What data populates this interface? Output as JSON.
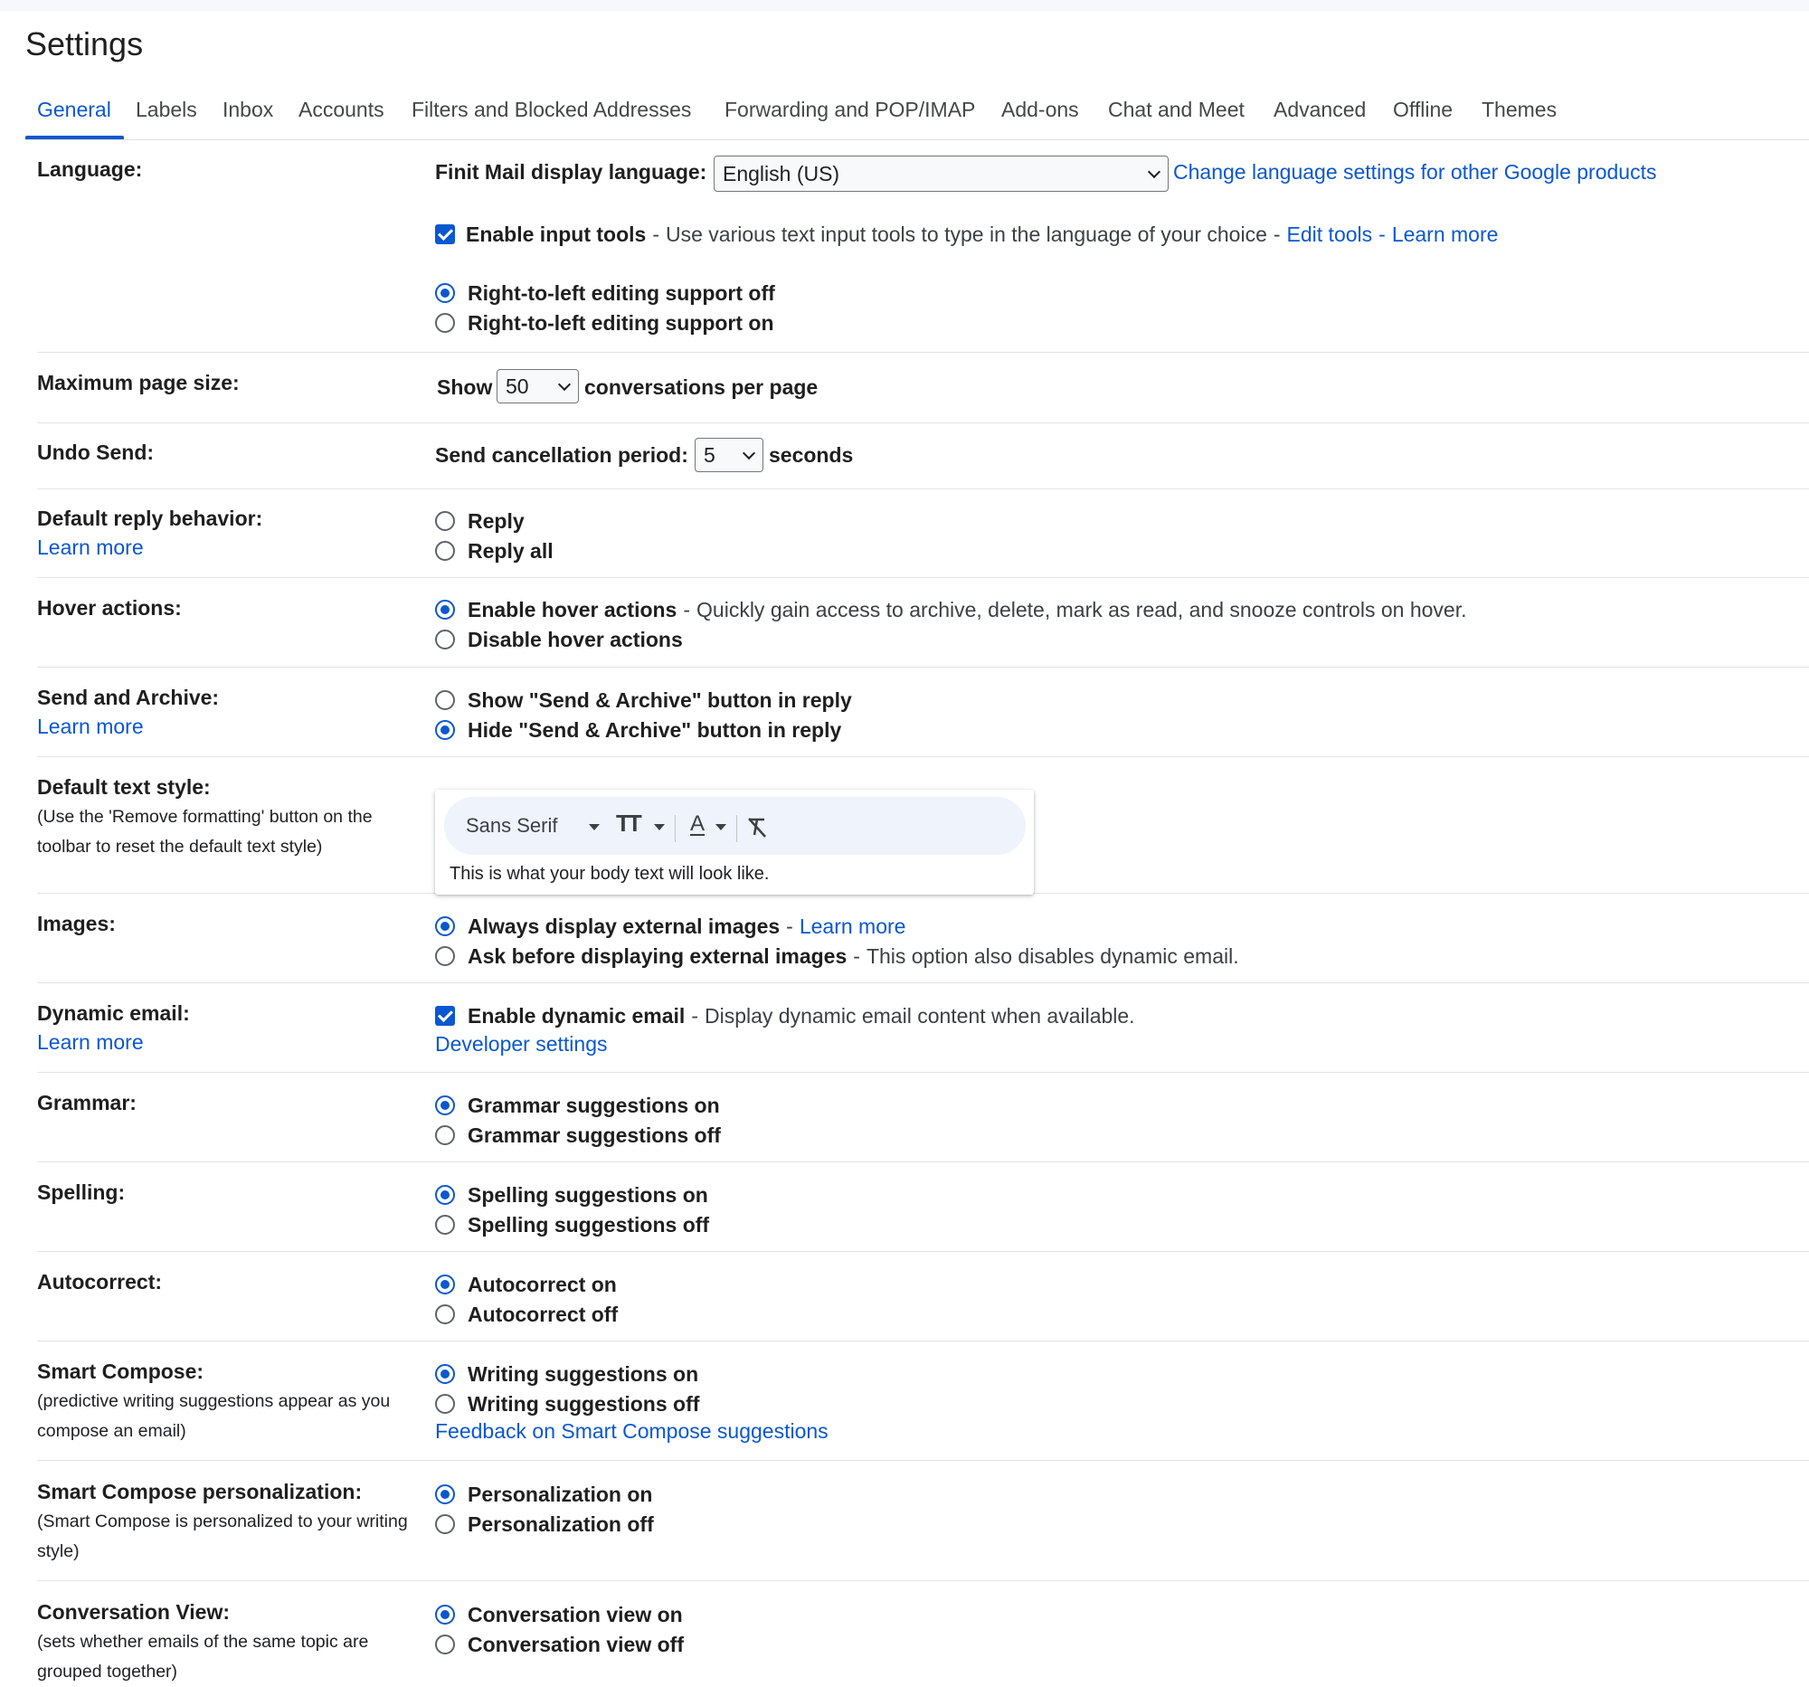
{
  "page": {
    "title": "Settings"
  },
  "tabs": [
    "General",
    "Labels",
    "Inbox",
    "Accounts",
    "Filters and Blocked Addresses",
    "Forwarding and POP/IMAP",
    "Add-ons",
    "Chat and Meet",
    "Advanced",
    "Offline",
    "Themes"
  ],
  "active_tab": "General",
  "language": {
    "label": "Language:",
    "display_label": "Finit Mail display language:",
    "selected": "English (US)",
    "change_link": "Change language settings for other Google products",
    "input_tools_label": "Enable input tools",
    "input_tools_desc": "Use various text input tools to type in the language of your choice",
    "edit_tools": "Edit tools",
    "learn_more": "Learn more",
    "rtl_off": "Right-to-left editing support off",
    "rtl_on": "Right-to-left editing support on"
  },
  "page_size": {
    "label": "Maximum page size:",
    "show": "Show",
    "value": "50",
    "suffix": "conversations per page"
  },
  "undo_send": {
    "label": "Undo Send:",
    "prefix": "Send cancellation period:",
    "value": "5",
    "suffix": "seconds"
  },
  "reply": {
    "label": "Default reply behavior:",
    "learn_more": "Learn more",
    "opt1": "Reply",
    "opt2": "Reply all"
  },
  "hover": {
    "label": "Hover actions:",
    "opt1": "Enable hover actions",
    "opt1_desc": "Quickly gain access to archive, delete, mark as read, and snooze controls on hover.",
    "opt2": "Disable hover actions"
  },
  "send_archive": {
    "label": "Send and Archive:",
    "learn_more": "Learn more",
    "opt1": "Show \"Send & Archive\" button in reply",
    "opt2": "Hide \"Send & Archive\" button in reply"
  },
  "text_style": {
    "label": "Default text style:",
    "sub": "(Use the 'Remove formatting' button on the toolbar to reset the default text style)",
    "font": "Sans Serif",
    "preview": "This is what your body text will look like."
  },
  "images": {
    "label": "Images:",
    "opt1": "Always display external images",
    "learn_more": "Learn more",
    "opt2": "Ask before displaying external images",
    "opt2_desc": "This option also disables dynamic email."
  },
  "dynamic": {
    "label": "Dynamic email:",
    "learn_more": "Learn more",
    "opt1": "Enable dynamic email",
    "opt1_desc": "Display dynamic email content when available.",
    "dev_settings": "Developer settings"
  },
  "grammar": {
    "label": "Grammar:",
    "opt1": "Grammar suggestions on",
    "opt2": "Grammar suggestions off"
  },
  "spelling": {
    "label": "Spelling:",
    "opt1": "Spelling suggestions on",
    "opt2": "Spelling suggestions off"
  },
  "autocorrect": {
    "label": "Autocorrect:",
    "opt1": "Autocorrect on",
    "opt2": "Autocorrect off"
  },
  "smart_compose": {
    "label": "Smart Compose:",
    "sub": "(predictive writing suggestions appear as you compose an email)",
    "opt1": "Writing suggestions on",
    "opt2": "Writing suggestions off",
    "feedback": "Feedback on Smart Compose suggestions"
  },
  "personalization": {
    "label": "Smart Compose personalization:",
    "sub": "(Smart Compose is personalized to your writing style)",
    "opt1": "Personalization on",
    "opt2": "Personalization off"
  },
  "conversation": {
    "label": "Conversation View:",
    "sub": "(sets whether emails of the same topic are grouped together)",
    "opt1": "Conversation view on",
    "opt2": "Conversation view off"
  },
  "colors": {
    "accent": "#0b57d0",
    "divider": "#e3e3e3",
    "toolbar_bg": "#eef3fc"
  },
  "icons": [
    "dropdown-chevron-icon",
    "caret-down-icon",
    "text-size-icon",
    "text-color-icon",
    "remove-formatting-icon",
    "checkbox-checked-icon",
    "radio-selected-icon",
    "radio-unselected-icon"
  ]
}
